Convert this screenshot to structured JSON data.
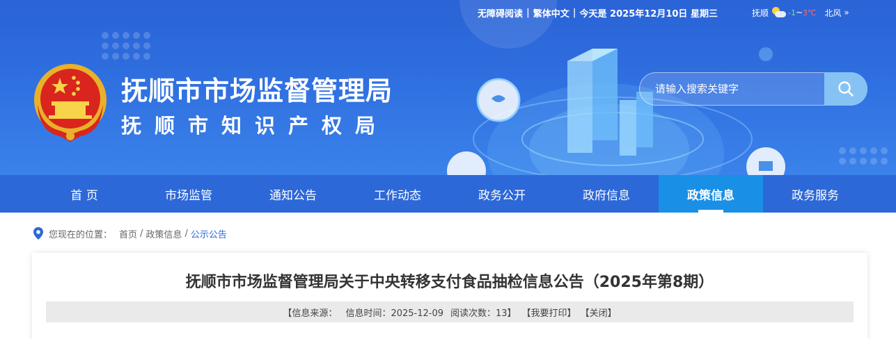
{
  "header": {
    "topbar": {
      "accessibility": "无障碍阅读",
      "traditional": "繁体中文",
      "today": "今天是 2025年12月10日 星期三"
    },
    "weather": {
      "city": "抚顺",
      "temp_low": "-1",
      "tilde": "~",
      "temp_high": "3℃",
      "wind": "北风",
      "more": "»"
    },
    "title": "抚顺市市场监督管理局",
    "subtitle": "抚顺市知识产权局",
    "search": {
      "placeholder": "请输入搜索关键字"
    }
  },
  "nav": {
    "items": [
      {
        "label": "首 页"
      },
      {
        "label": "市场监管"
      },
      {
        "label": "通知公告"
      },
      {
        "label": "工作动态"
      },
      {
        "label": "政务公开"
      },
      {
        "label": "政府信息"
      },
      {
        "label": "政策信息"
      },
      {
        "label": "政务服务"
      }
    ],
    "active_index": 6
  },
  "breadcrumb": {
    "label": "您现在的位置：",
    "items": [
      "首页",
      "政策信息",
      "公示公告"
    ]
  },
  "article": {
    "title": "抚顺市市场监督管理局关于中央转移支付食品抽检信息公告（2025年第8期）",
    "meta": {
      "source": "【信息来源：",
      "time": "信息时间：2025-12-09",
      "views": "阅读次数：13】",
      "print": "【我要打印】",
      "close": "【关闭】"
    }
  },
  "colors": {
    "nav_bg": "#2d68d8",
    "nav_active": "#1a8fe6",
    "banner": "#2f6fe0"
  }
}
